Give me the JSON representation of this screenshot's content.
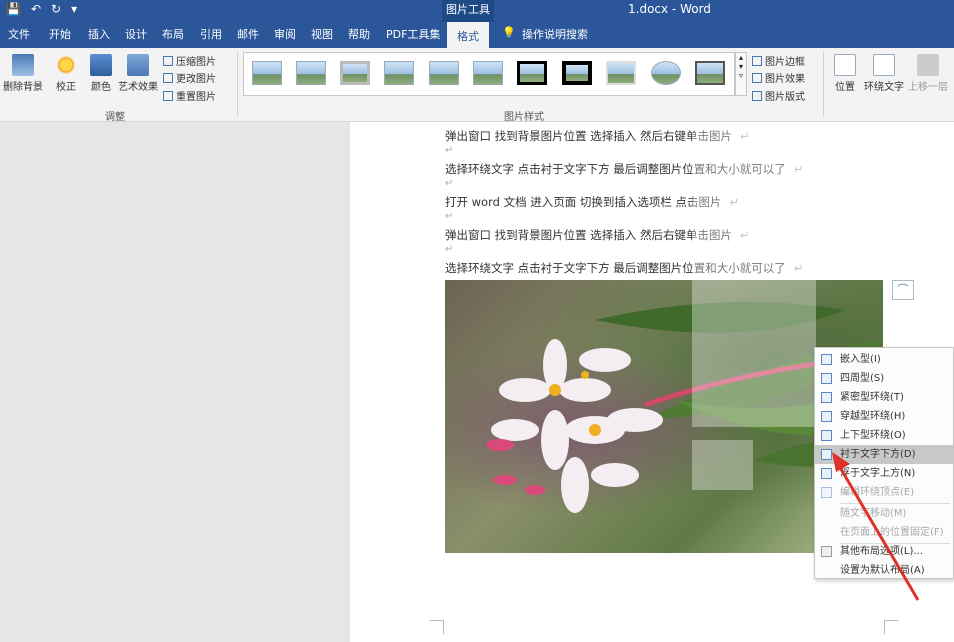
{
  "titlebar": {
    "qat": [
      "💾",
      "↶",
      "↻",
      "▾"
    ],
    "context_tab": "图片工具",
    "doc_title": "1.docx  -  Word"
  },
  "menu": {
    "tabs": [
      "文件",
      "开始",
      "插入",
      "设计",
      "布局",
      "引用",
      "邮件",
      "审阅",
      "视图",
      "帮助",
      "PDF工具集",
      "格式"
    ],
    "tell_me": "操作说明搜索"
  },
  "ribbon": {
    "remove_bg": "删除背景",
    "correct": "校正",
    "color": "颜色",
    "artistic": "艺术效果",
    "compress": "压缩图片",
    "change": "更改图片",
    "reset": "重置图片",
    "group_adjust": "调整",
    "group_styles": "图片样式",
    "border": "图片边框",
    "effects": "图片效果",
    "layout": "图片版式",
    "position": "位置",
    "wrap": "环绕文字",
    "bring_forward": "上移一层"
  },
  "document": {
    "lines": [
      "弹出窗口   找到背景图片位置   选择插入   然后右键单击图片",
      "选择环绕文字   点击衬于文字下方   最后调整图片位置和大小就可以了",
      "打开 word 文档   进入页面   切换到插入选项栏   点击图片",
      "弹出窗口   找到背景图片位置   选择插入   然后右键单击图片",
      "选择环绕文字   点击衬于文字下方   最后调整图片位置和大小就可以了"
    ],
    "para_mark": "↵"
  },
  "context_menu": {
    "items": [
      {
        "label": "嵌入型(I)",
        "state": "normal"
      },
      {
        "label": "四周型(S)",
        "state": "normal"
      },
      {
        "label": "紧密型环绕(T)",
        "state": "normal"
      },
      {
        "label": "穿越型环绕(H)",
        "state": "normal"
      },
      {
        "label": "上下型环绕(O)",
        "state": "normal"
      },
      {
        "label": "衬于文字下方(D)",
        "state": "hover"
      },
      {
        "label": "浮于文字上方(N)",
        "state": "normal"
      },
      {
        "label": "编辑环绕顶点(E)",
        "state": "disabled"
      },
      {
        "label": "随文字移动(M)",
        "state": "disabled"
      },
      {
        "label": "在页面上的位置固定(F)",
        "state": "disabled"
      },
      {
        "label": "其他布局选项(L)...",
        "state": "normal"
      },
      {
        "label": "设置为默认布局(A)",
        "state": "normal"
      }
    ]
  },
  "colors": {
    "title_bar": "#2b579a",
    "ribbon_bg": "#f3f3f3",
    "arrow": "#e0302a"
  }
}
